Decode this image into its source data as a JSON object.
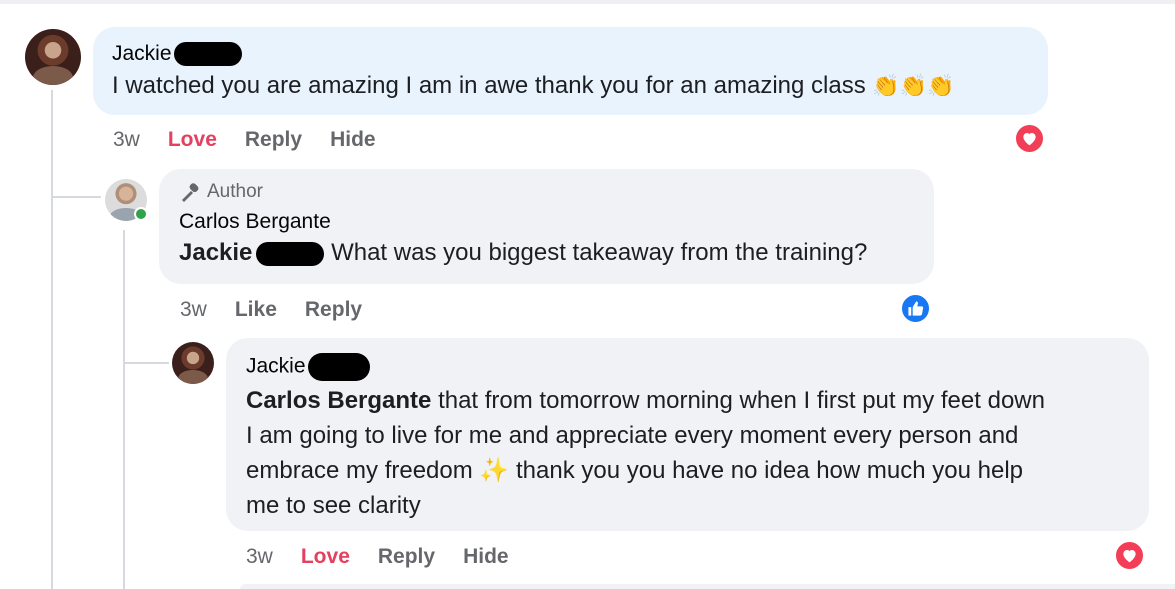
{
  "comments": [
    {
      "name": "Jackie",
      "text": "I watched you are amazing I am in awe thank you for an amazing class",
      "emoji": "👏👏👏",
      "time": "3w",
      "actions": [
        "Love",
        "Reply",
        "Hide"
      ],
      "reaction": "heart"
    },
    {
      "badge": "Author",
      "name": "Carlos Bergante",
      "mention": "Jackie",
      "text": "What was you biggest takeaway from the training?",
      "time": "3w",
      "actions": [
        "Like",
        "Reply"
      ],
      "reaction": "like",
      "online": true
    },
    {
      "name": "Jackie",
      "mention": "Carlos Bergante",
      "text_part1": "that from tomorrow morning when I first put my feet down",
      "text_part2": "I am going to live for me and appreciate every moment every person and",
      "text_part3": "embrace my freedom",
      "emoji": "✨",
      "text_part4": "thank you you have no idea how much you help",
      "text_part5": "me to see clarity",
      "time": "3w",
      "actions": [
        "Love",
        "Reply",
        "Hide"
      ],
      "reaction": "heart"
    }
  ],
  "colors": {
    "love": "#e4405f",
    "like": "#1877f2",
    "bubble_highlight": "#e8f3fd",
    "bubble": "#f0f2f5"
  }
}
